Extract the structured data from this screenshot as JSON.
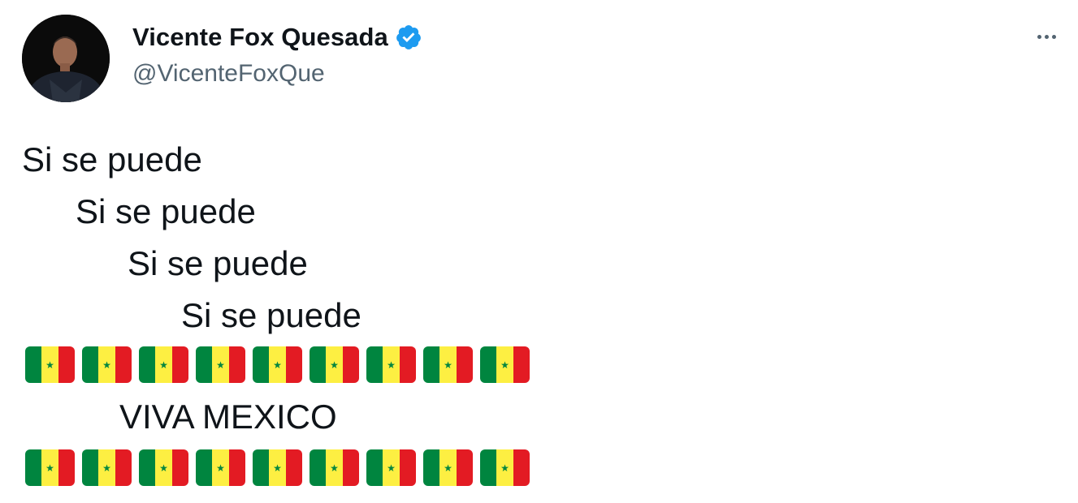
{
  "author": {
    "display_name": "Vicente Fox Quesada",
    "handle": "@VicenteFoxQue",
    "verified": true,
    "avatar_icon": "profile-photo"
  },
  "more_icon": "ellipsis-icon",
  "tweet": {
    "lines": [
      "Si se puede",
      "Si se puede",
      "Si se puede",
      "Si se puede"
    ],
    "closing": "VIVA MEXICO",
    "flag_rows": [
      {
        "count": 9,
        "flag": "senegal-flag-emoji"
      },
      {
        "count": 9,
        "flag": "senegal-flag-emoji"
      }
    ]
  },
  "colors": {
    "name": "#0f1419",
    "handle": "#536471",
    "verified": "#1d9bf0",
    "flag_green": "#00853f",
    "flag_yellow": "#fdef42",
    "flag_red": "#e31b23",
    "flag_star": "#00853f"
  }
}
